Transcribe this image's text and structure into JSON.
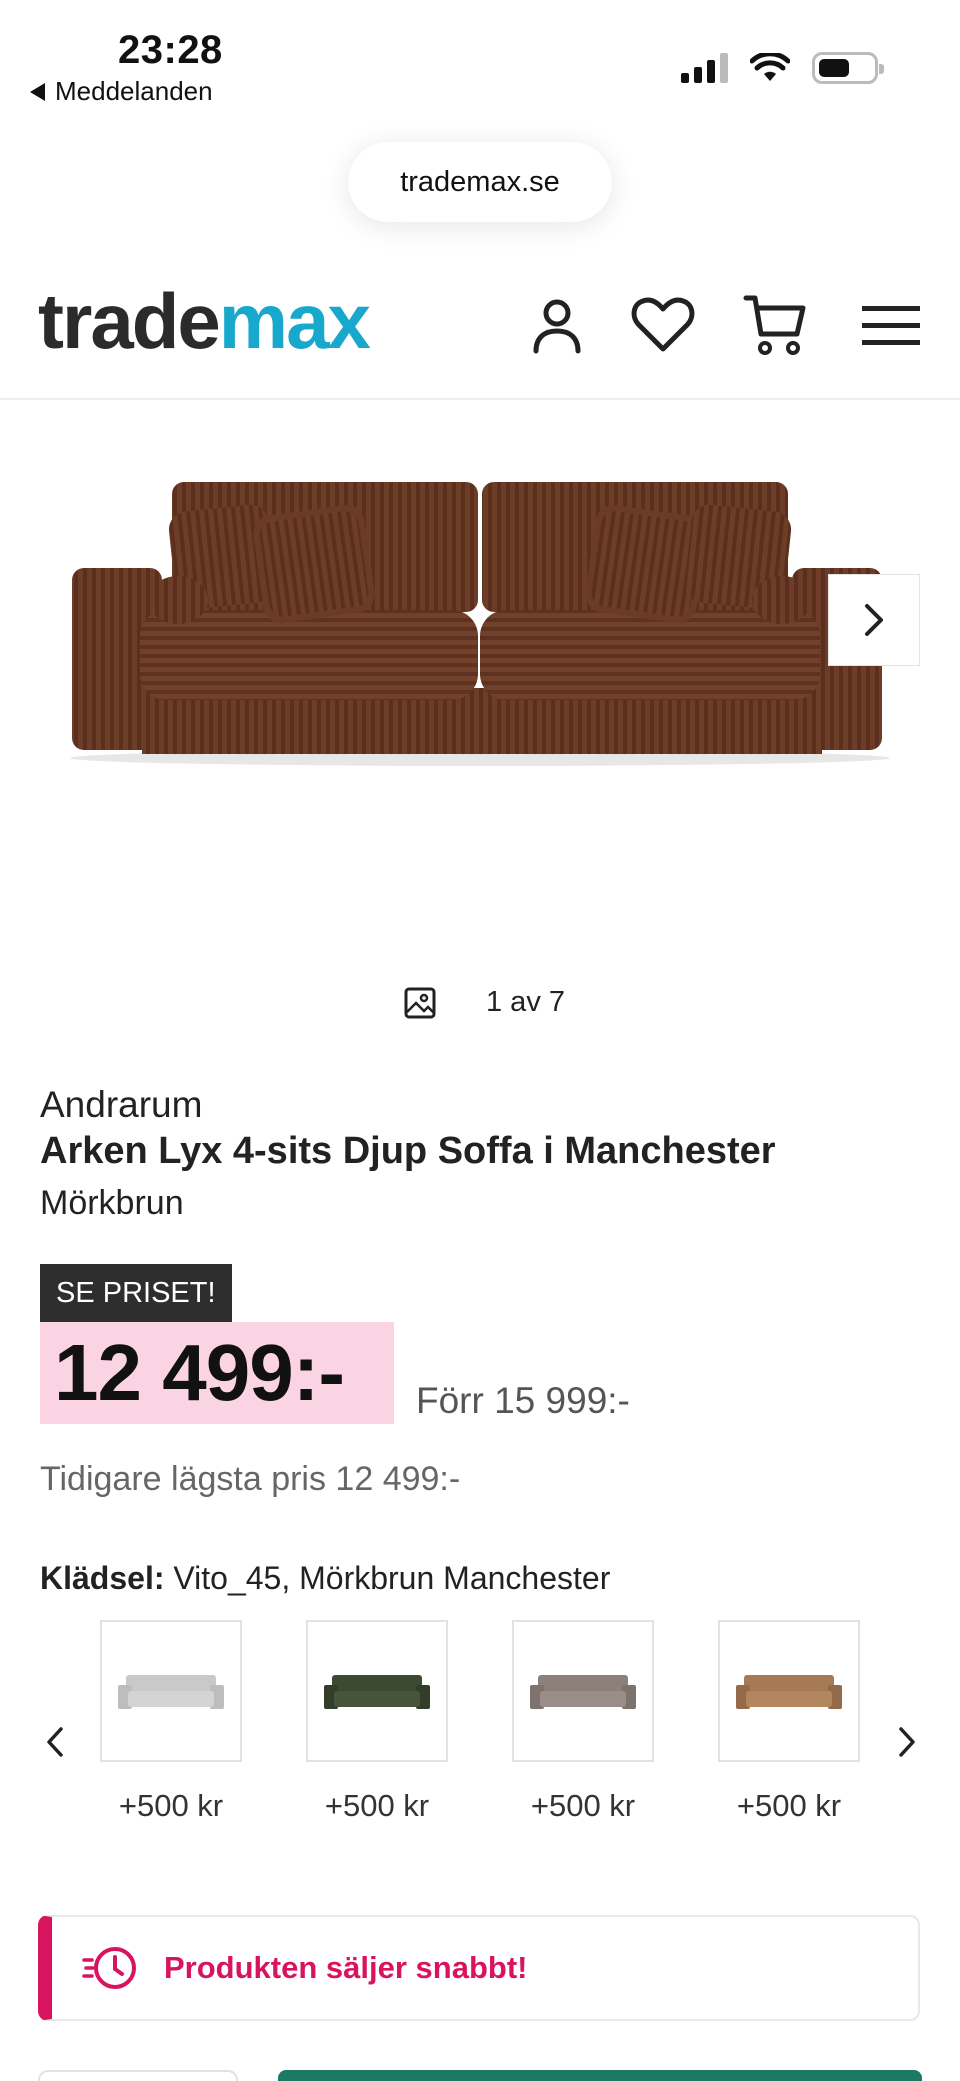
{
  "status_bar": {
    "time": "23:28",
    "back_label": "Meddelanden",
    "icons": [
      "signal-icon",
      "wifi-icon",
      "battery-icon"
    ]
  },
  "browser": {
    "url": "trademax.se"
  },
  "header": {
    "logo_part1": "trade",
    "logo_part2": "max",
    "logo_colors": {
      "trade": "#2b2b2b",
      "max": "#17a8cc"
    },
    "icons": [
      "account-icon",
      "heart-icon",
      "cart-icon",
      "menu-icon"
    ]
  },
  "gallery": {
    "counter": "1 av 7",
    "icons": [
      "image-icon",
      "chevron-right-icon"
    ]
  },
  "product": {
    "brand": "Andrarum",
    "title": "Arken Lyx 4-sits Djup Soffa i Manchester",
    "variant": "Mörkbrun",
    "badge": "SE PRISET!",
    "price": "12 499:-",
    "old_price": "Förr 15 999:-",
    "lowest_price": "Tidigare lägsta pris 12 499:-",
    "price_highlight_color": "#fbd4e4"
  },
  "upholstery": {
    "label": "Klädsel:",
    "value": "Vito_45, Mörkbrun Manchester",
    "swatches": [
      {
        "price": "+500 kr",
        "color": "#c9c9c9"
      },
      {
        "price": "+500 kr",
        "color": "#3d4a33"
      },
      {
        "price": "+500 kr",
        "color": "#8d807b"
      },
      {
        "price": "+500 kr",
        "color": "#a67a56"
      }
    ]
  },
  "urgency": {
    "text": "Produkten säljer snabbt!",
    "color": "#d9145f"
  }
}
